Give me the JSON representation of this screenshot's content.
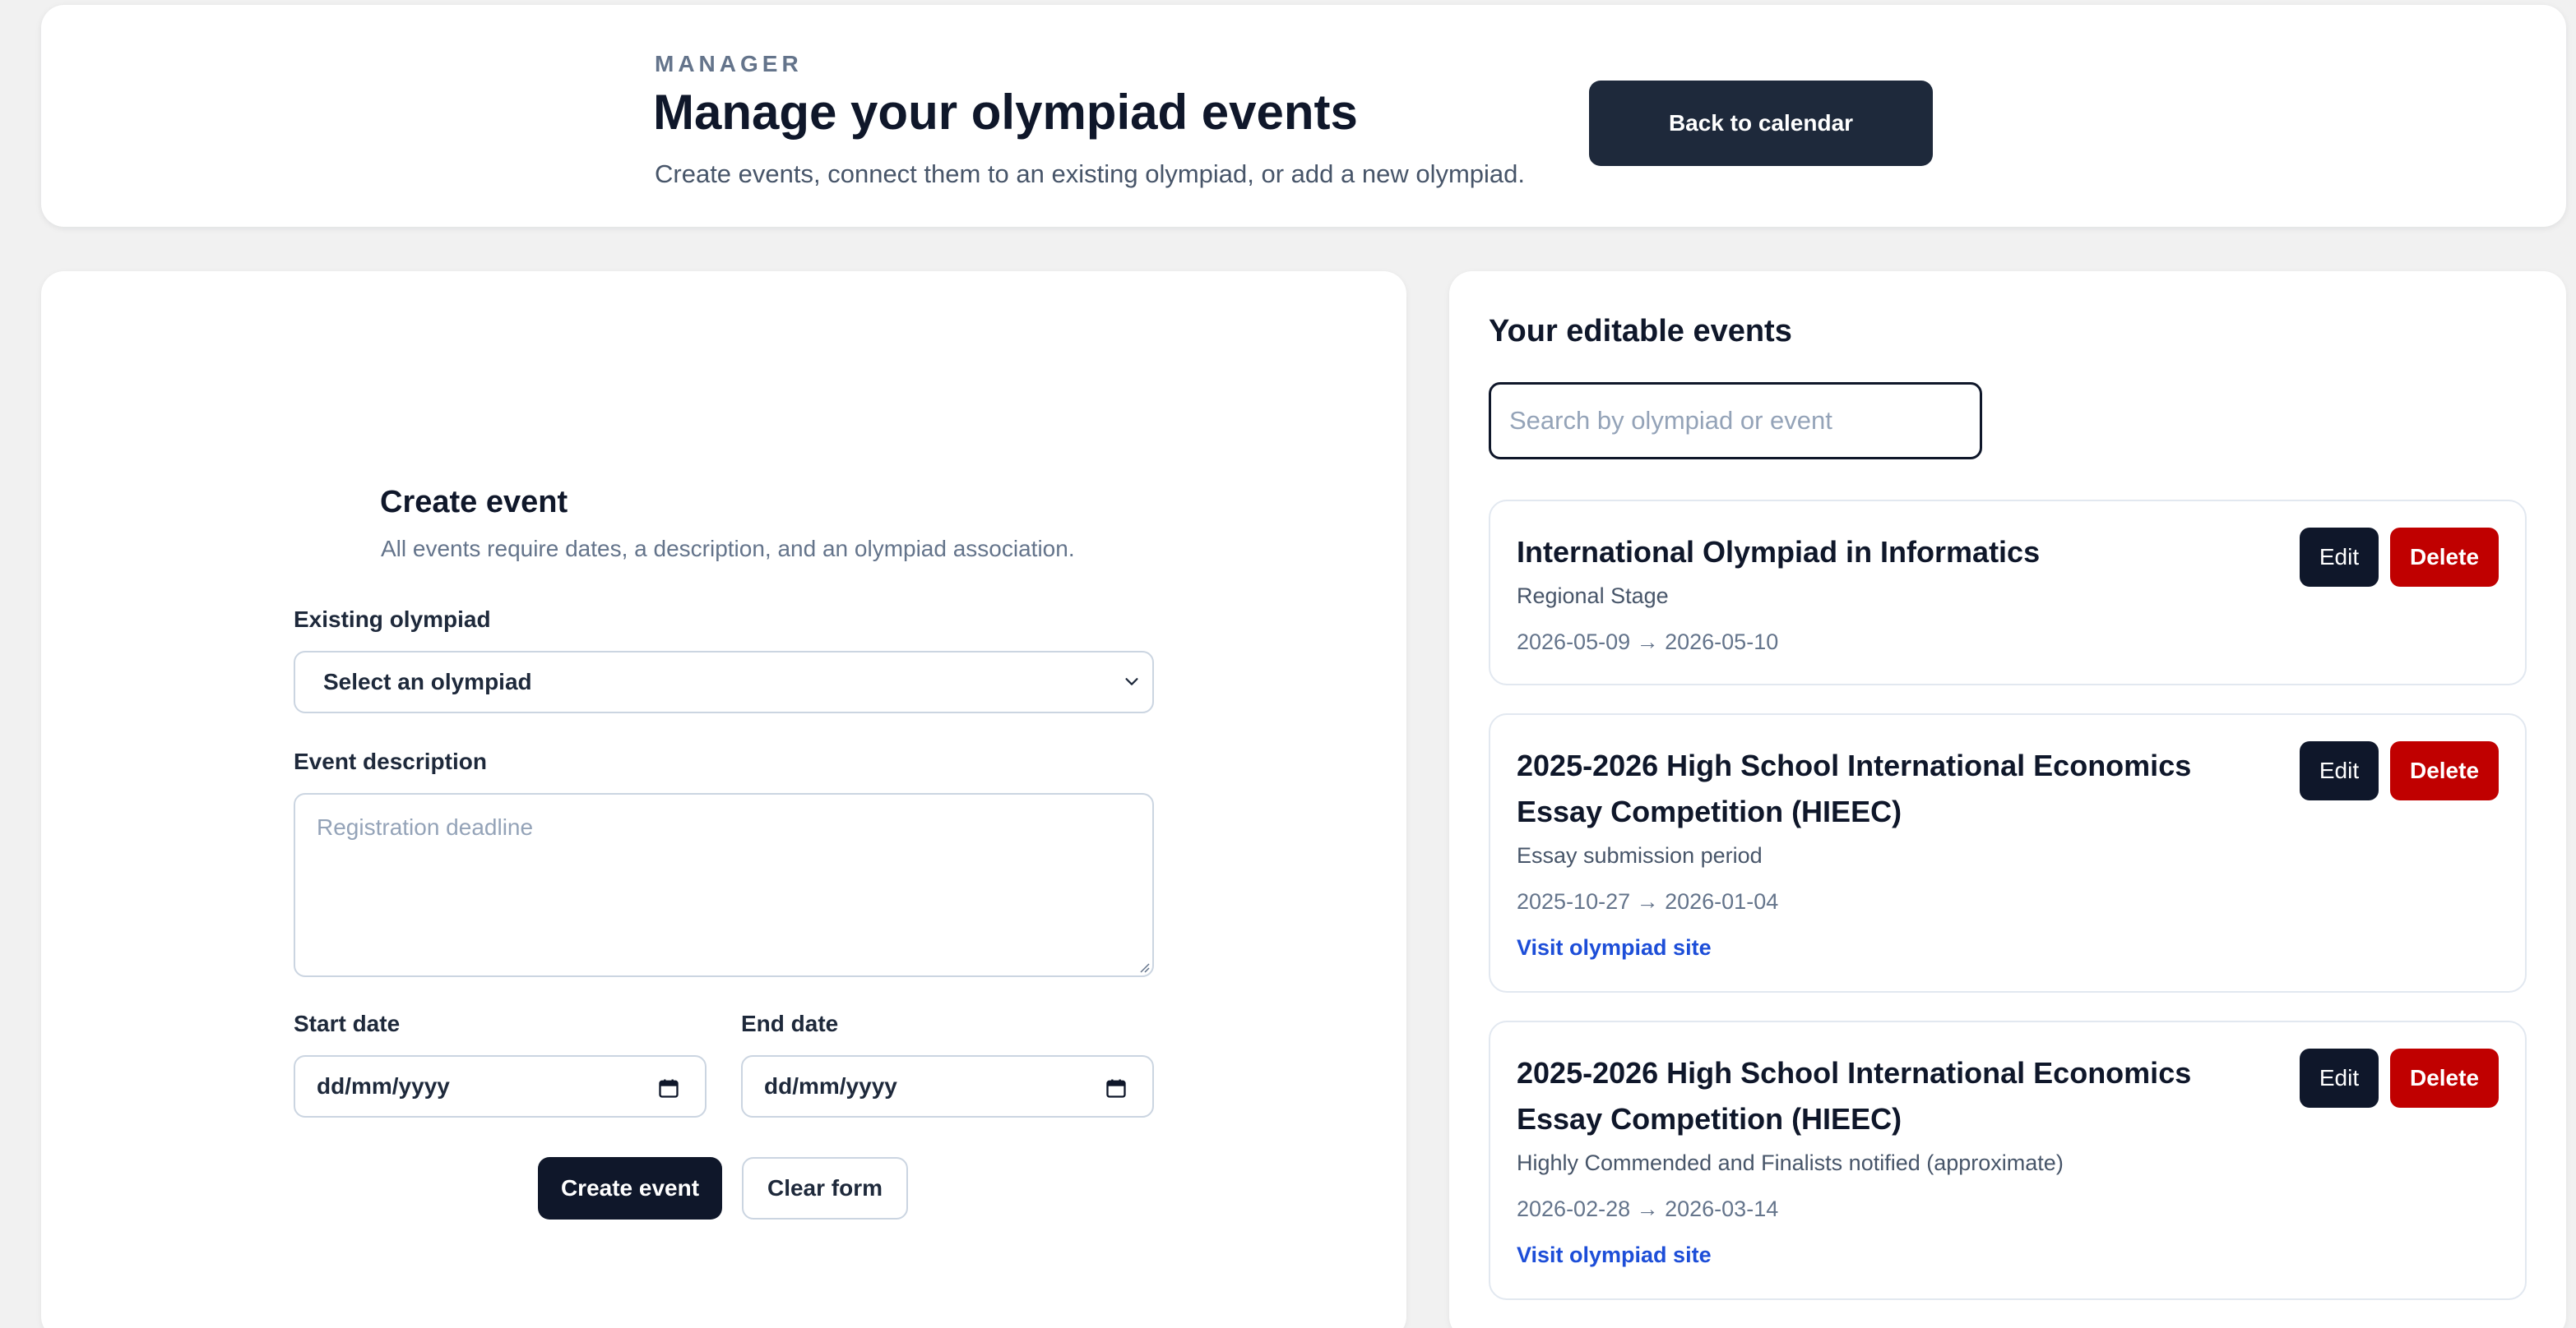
{
  "header": {
    "eyebrow": "MANAGER",
    "title": "Manage your olympiad events",
    "subtitle": "Create events, connect them to an existing olympiad, or add a new olympiad.",
    "back_label": "Back to calendar"
  },
  "create_form": {
    "title": "Create event",
    "subtitle": "All events require dates, a description, and an olympiad association.",
    "olympiad_label": "Existing olympiad",
    "olympiad_selected": "Select an olympiad",
    "description_label": "Event description",
    "description_placeholder": "Registration deadline",
    "start_label": "Start date",
    "start_value": "dd/mm/yyyy",
    "end_label": "End date",
    "end_value": "dd/mm/yyyy",
    "submit_label": "Create event",
    "clear_label": "Clear form"
  },
  "events_panel": {
    "title": "Your editable events",
    "search_placeholder": "Search by olympiad or event",
    "edit_label": "Edit",
    "delete_label": "Delete",
    "link_label": "Visit olympiad site",
    "items": [
      {
        "name": "International Olympiad in Informatics",
        "description": "Regional Stage",
        "dates": "2026-05-09 → 2026-05-10"
      },
      {
        "name": "2025-2026 High School International Economics Essay Competition (HIEEC)",
        "description": "Essay submission period",
        "dates": "2025-10-27 → 2026-01-04"
      },
      {
        "name": "2025-2026 High School International Economics Essay Competition (HIEEC)",
        "description": "Highly Commended and Finalists notified (approximate)",
        "dates": "2026-02-28 → 2026-03-14"
      }
    ]
  },
  "colors": {
    "primary_dark": "#0f172a",
    "header_button": "#1e293b",
    "danger": "#c00000",
    "link": "#1d4ed8",
    "background": "#f1f1f1"
  }
}
